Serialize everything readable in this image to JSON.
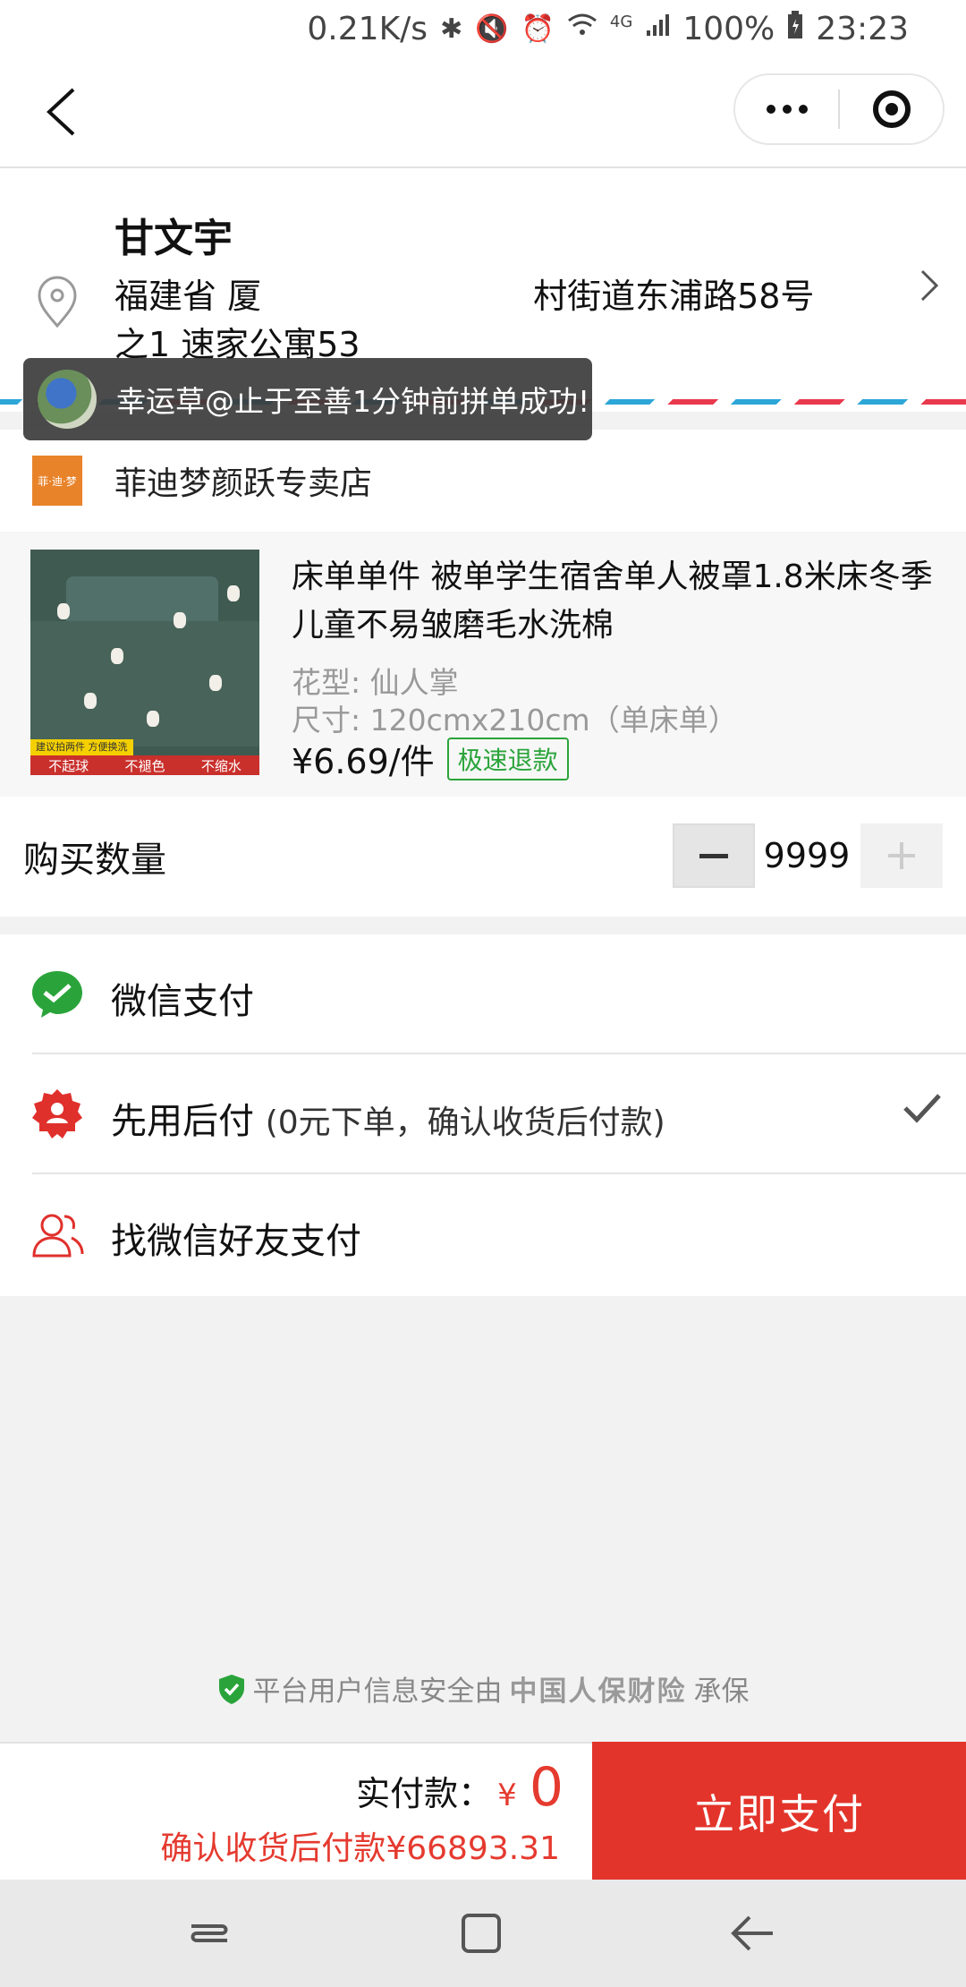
{
  "status_bar": {
    "speed": "0.21K/s",
    "battery": "100%",
    "time": "23:23",
    "network": "4G"
  },
  "address": {
    "name": "甘文宇",
    "line": "福建省 厦　　　　　　　　村街道东浦路58号之1 速家公寓53"
  },
  "toast": {
    "text": "幸运草@止于至善1分钟前拼单成功!"
  },
  "store": {
    "logo_text": "菲·迪·梦",
    "name": "菲迪梦颜跃专卖店"
  },
  "product": {
    "title": "床单单件 被单学生宿舍单人被罩1.8米床冬季儿童不易皱磨毛水洗棉",
    "pattern": "花型: 仙人掌",
    "size": "尺寸: 120cmx210cm（单床单）",
    "price": "¥6.69/件",
    "refund_badge": "极速退款",
    "image_tip": "建议拍两件 方便换洗",
    "image_band": [
      "不起球",
      "不褪色",
      "不缩水"
    ]
  },
  "quantity": {
    "label": "购买数量",
    "value": "9999"
  },
  "payment": {
    "wechat": "微信支付",
    "later": "先用后付",
    "later_sub": "(0元下单，确认收货后付款)",
    "friend": "找微信好友支付",
    "selected": "later"
  },
  "security_note": {
    "prefix": "平台用户信息安全由",
    "brand": "中国人保财险",
    "suffix": "承保"
  },
  "checkout": {
    "total_label": "实付款：",
    "currency": "¥",
    "total_value": "0",
    "later_note": "确认收货后付款¥66893.31",
    "pay_button": "立即支付"
  },
  "colors": {
    "accent_red": "#e3342b",
    "wechat_green": "#2aa43a",
    "store_orange": "#e8832a"
  }
}
